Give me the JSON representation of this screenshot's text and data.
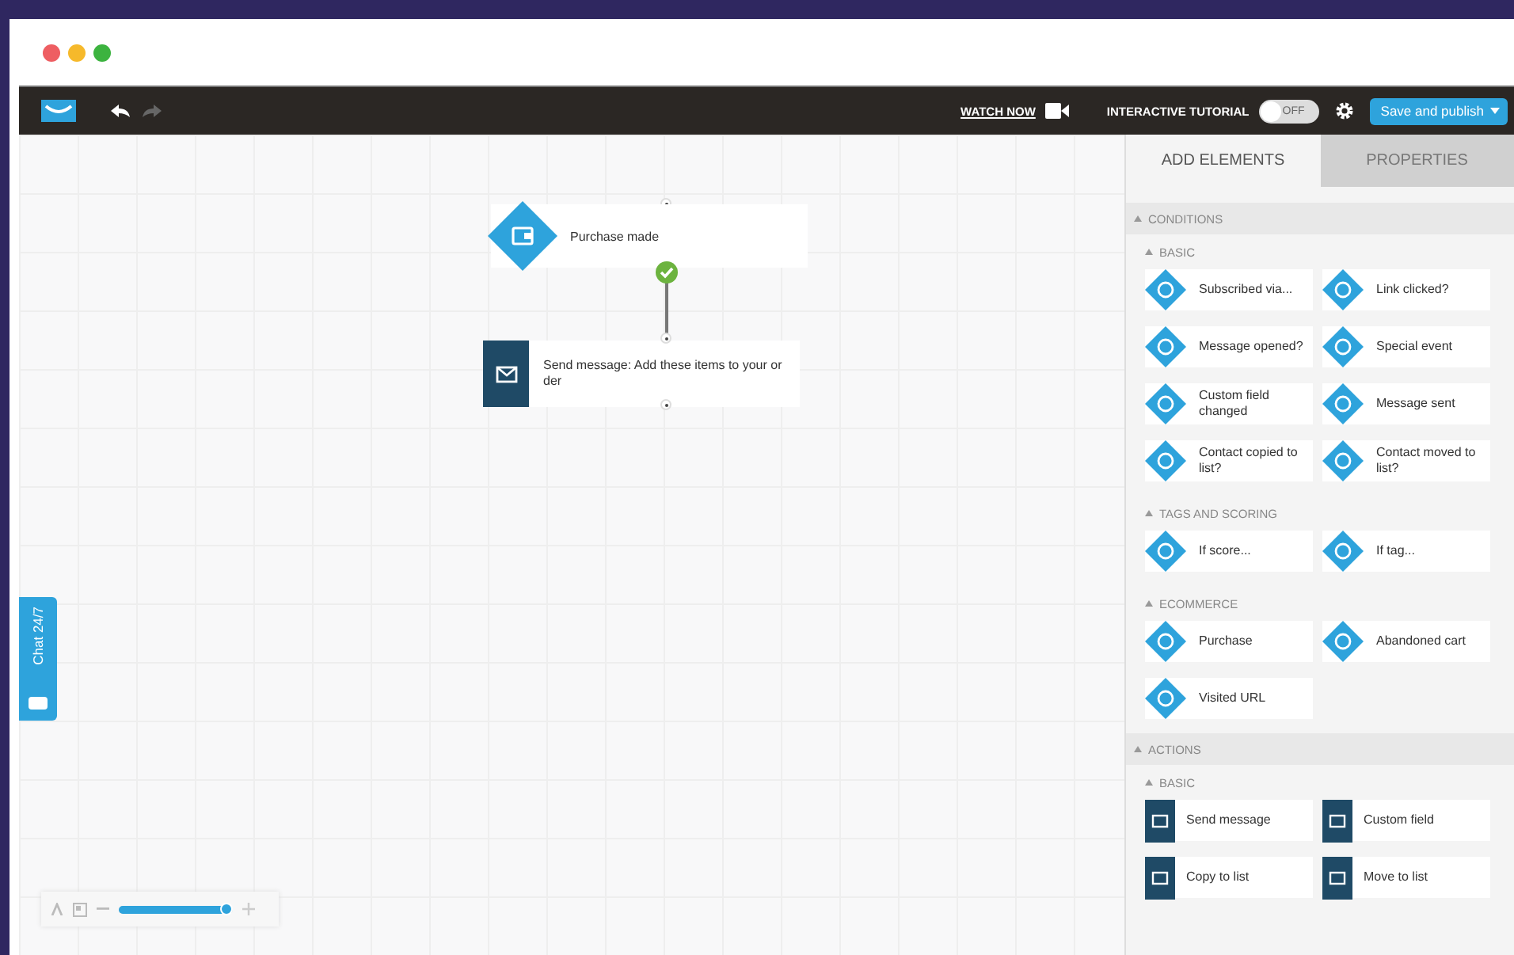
{
  "window": {
    "dots": [
      {
        "color": "#ee5e62"
      },
      {
        "color": "#f6b92b"
      },
      {
        "color": "#3cb33f"
      }
    ]
  },
  "toolbar": {
    "watch_now": "WATCH NOW",
    "tutorial": {
      "label": "INTERACTIVE TUTORIAL",
      "on": false,
      "state_text": "OFF"
    },
    "publish": "Save and publish"
  },
  "canvas": {
    "nodes": [
      {
        "kind": "condition",
        "label": "Purchase made"
      },
      {
        "kind": "action",
        "label": "Send message: Add these items to your order"
      }
    ],
    "chat_tab": "Chat 24/7",
    "zoom": {
      "level": 0.95
    }
  },
  "panel": {
    "tabs": [
      {
        "label": "ADD ELEMENTS",
        "selected": true
      },
      {
        "label": "PROPERTIES",
        "selected": false
      }
    ],
    "sections": [
      {
        "title": "CONDITIONS",
        "expanded": true,
        "groups": [
          {
            "title": "BASIC",
            "expanded": true,
            "items": [
              {
                "kind": "condition",
                "label": "Subscribed via..."
              },
              {
                "kind": "condition",
                "label": "Link clicked?"
              },
              {
                "kind": "condition",
                "label": "Message opened?"
              },
              {
                "kind": "condition",
                "label": "Special event"
              },
              {
                "kind": "condition",
                "label": "Custom field changed"
              },
              {
                "kind": "condition",
                "label": "Message sent"
              },
              {
                "kind": "condition",
                "label": "Contact copied to list?"
              },
              {
                "kind": "condition",
                "label": "Contact moved to list?"
              }
            ]
          },
          {
            "title": "TAGS AND SCORING",
            "expanded": true,
            "items": [
              {
                "kind": "condition",
                "label": "If score..."
              },
              {
                "kind": "condition",
                "label": "If tag..."
              }
            ]
          },
          {
            "title": "ECOMMERCE",
            "expanded": true,
            "items": [
              {
                "kind": "condition",
                "label": "Purchase"
              },
              {
                "kind": "condition",
                "label": "Abandoned cart"
              },
              {
                "kind": "condition",
                "label": "Visited URL"
              }
            ]
          }
        ]
      },
      {
        "title": "ACTIONS",
        "expanded": true,
        "groups": [
          {
            "title": "BASIC",
            "expanded": true,
            "items": [
              {
                "kind": "action",
                "label": "Send message"
              },
              {
                "kind": "action",
                "label": "Custom field"
              },
              {
                "kind": "action",
                "label": "Copy to list"
              },
              {
                "kind": "action",
                "label": "Move to list"
              }
            ]
          }
        ]
      }
    ]
  }
}
